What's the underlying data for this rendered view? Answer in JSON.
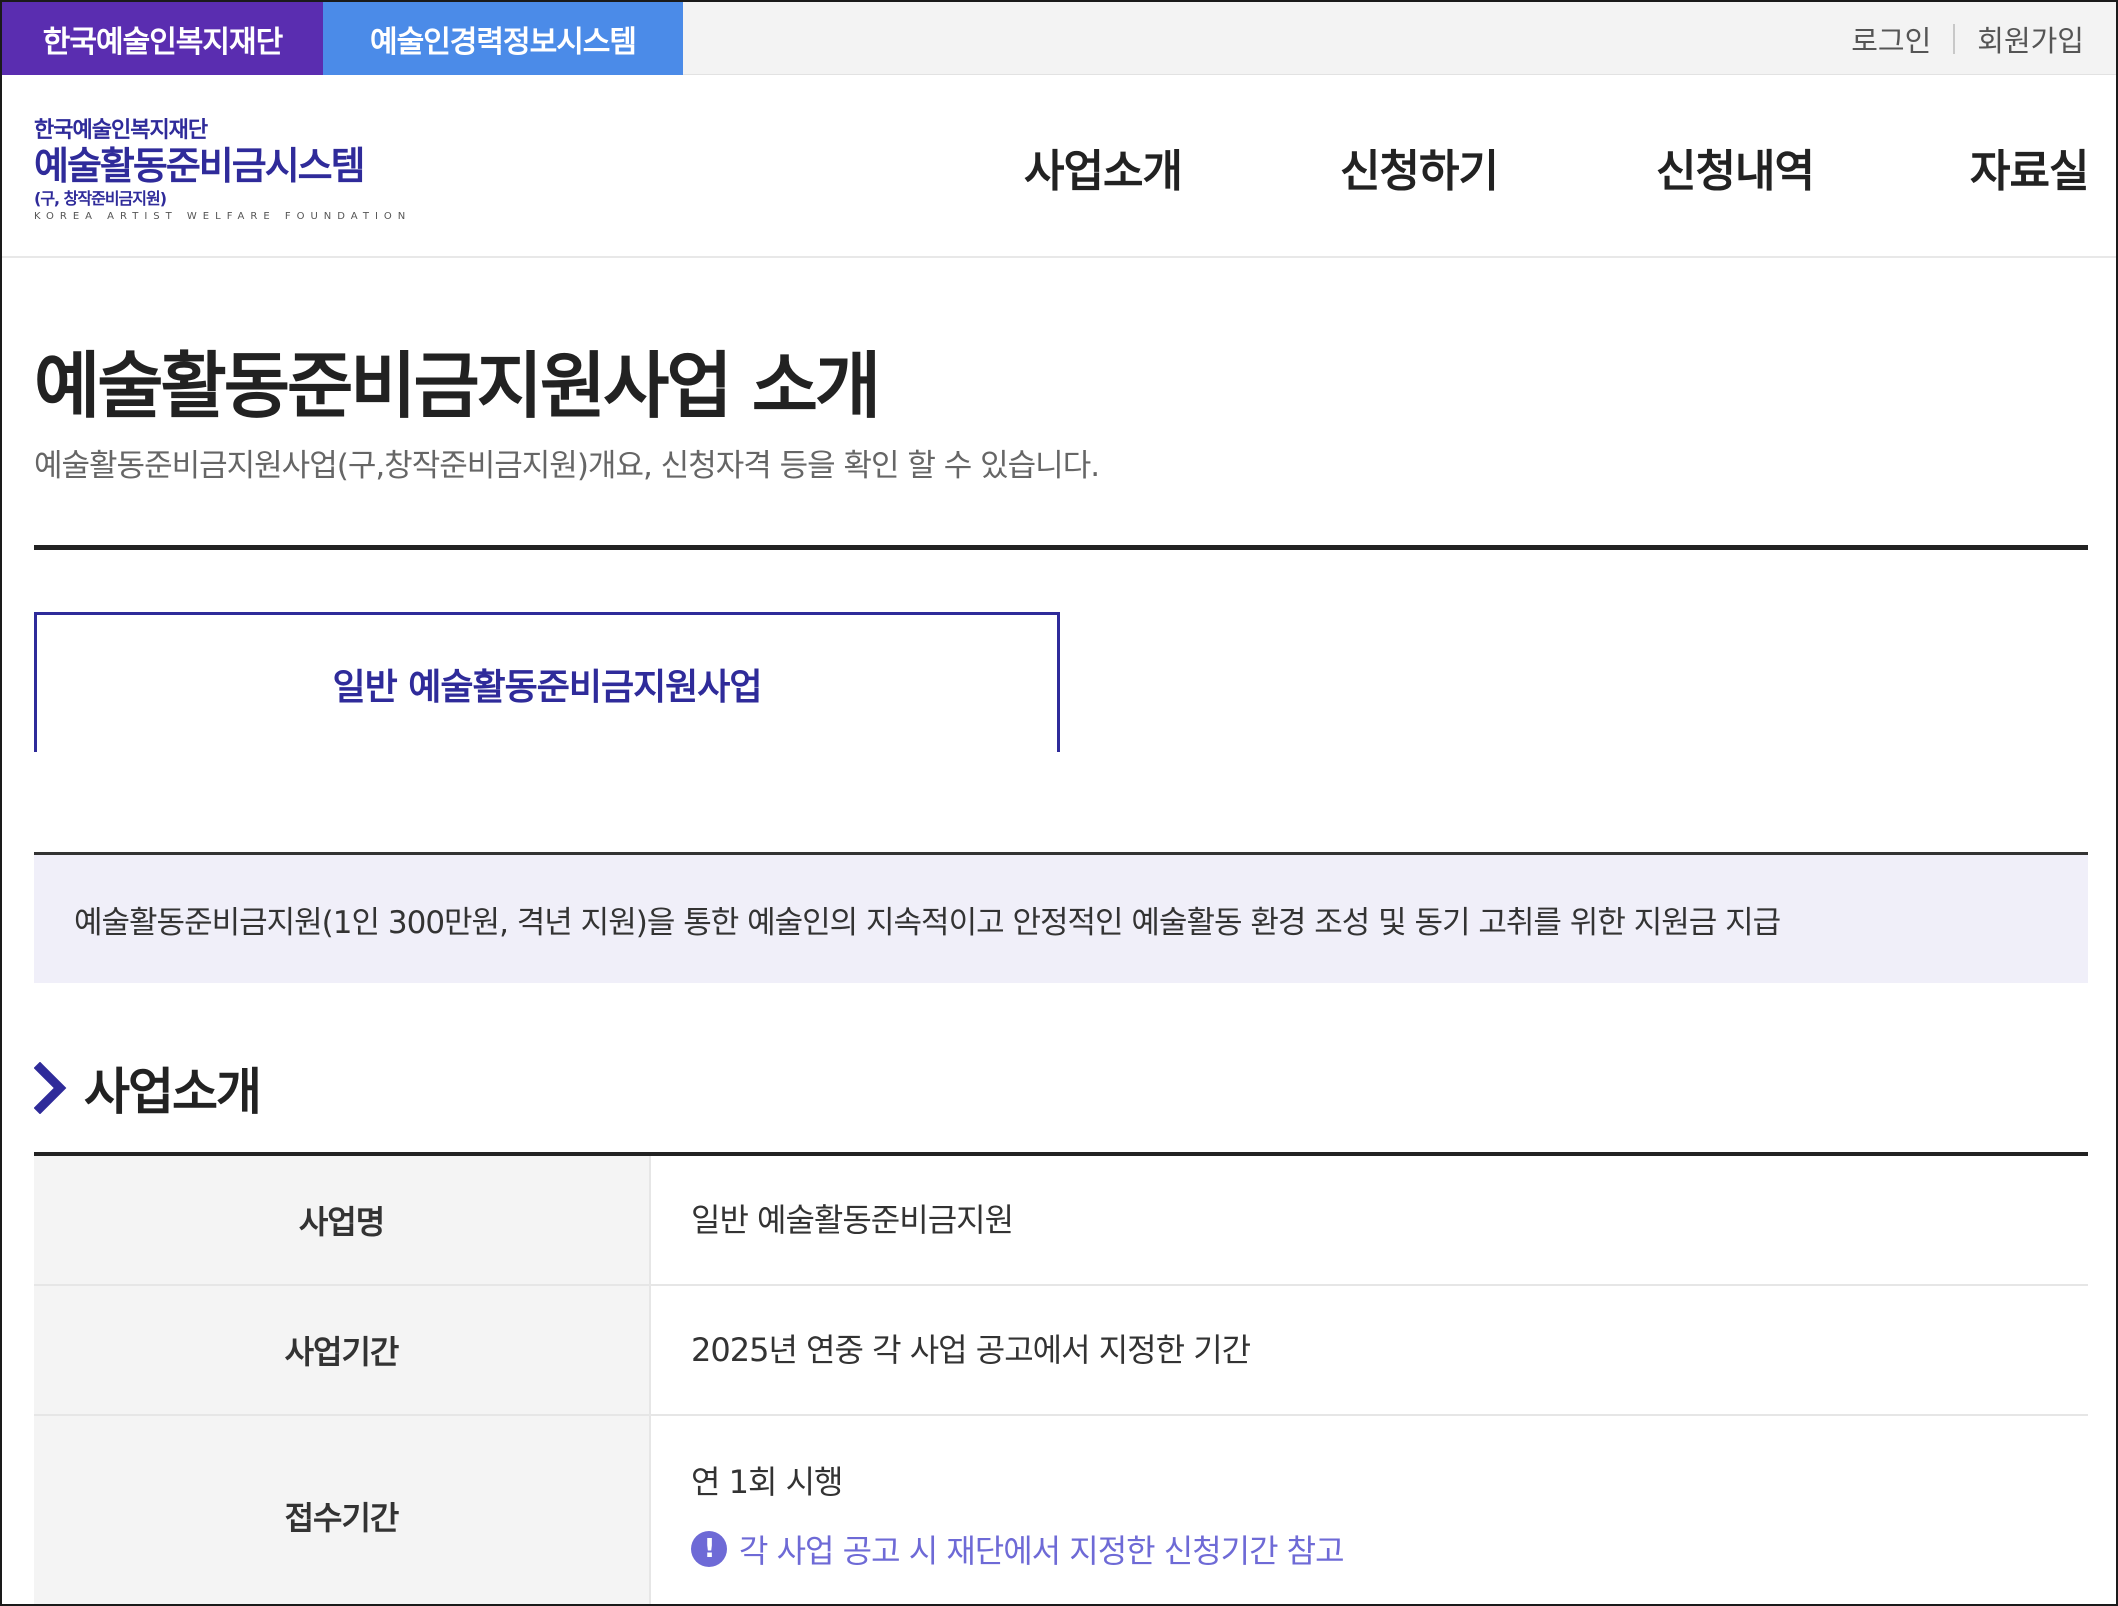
{
  "topbar": {
    "site_tabs": [
      {
        "label": "한국예술인복지재단"
      },
      {
        "label": "예술인경력정보시스템"
      }
    ],
    "login": "로그인",
    "signup": "회원가입"
  },
  "header": {
    "logo": {
      "org": "한국예술인복지재단",
      "system": "예술활동준비금시스템",
      "former": "(구, 창작준비금지원)",
      "english": "KOREA ARTIST WELFARE FOUNDATION"
    },
    "nav": [
      {
        "label": "사업소개"
      },
      {
        "label": "신청하기"
      },
      {
        "label": "신청내역"
      },
      {
        "label": "자료실"
      }
    ]
  },
  "page": {
    "title": "예술활동준비금지원사업 소개",
    "description": "예술활동준비금지원사업(구,창작준비금지원)개요, 신청자격 등을 확인 할 수 있습니다."
  },
  "subtab": {
    "label": "일반 예술활동준비금지원사업"
  },
  "summary": "예술활동준비금지원(1인 300만원, 격년 지원)을 통한 예술인의 지속적이고 안정적인 예술활동 환경 조성 및 동기 고취를 위한 지원금 지급",
  "section": {
    "heading": "사업소개",
    "icon": "chevron-right-icon",
    "accent": "#2f2b9a"
  },
  "info_table": {
    "rows": [
      {
        "label": "사업명",
        "value": "일반 예술활동준비금지원"
      },
      {
        "label": "사업기간",
        "value": "2025년 연중 각 사업 공고에서 지정한 기간"
      },
      {
        "label": "접수기간",
        "value": "연 1회 시행",
        "notice": "각 사업 공고 시 재단에서 지정한 신청기간 참고",
        "notice_icon": "exclamation-circle-icon"
      }
    ]
  },
  "colors": {
    "tab_purple": "#5a2db0",
    "tab_blue": "#4b8be8",
    "brand_navy": "#2f2b9a",
    "summary_bg": "#f0eff9",
    "notice_text": "#6e6ad6"
  }
}
